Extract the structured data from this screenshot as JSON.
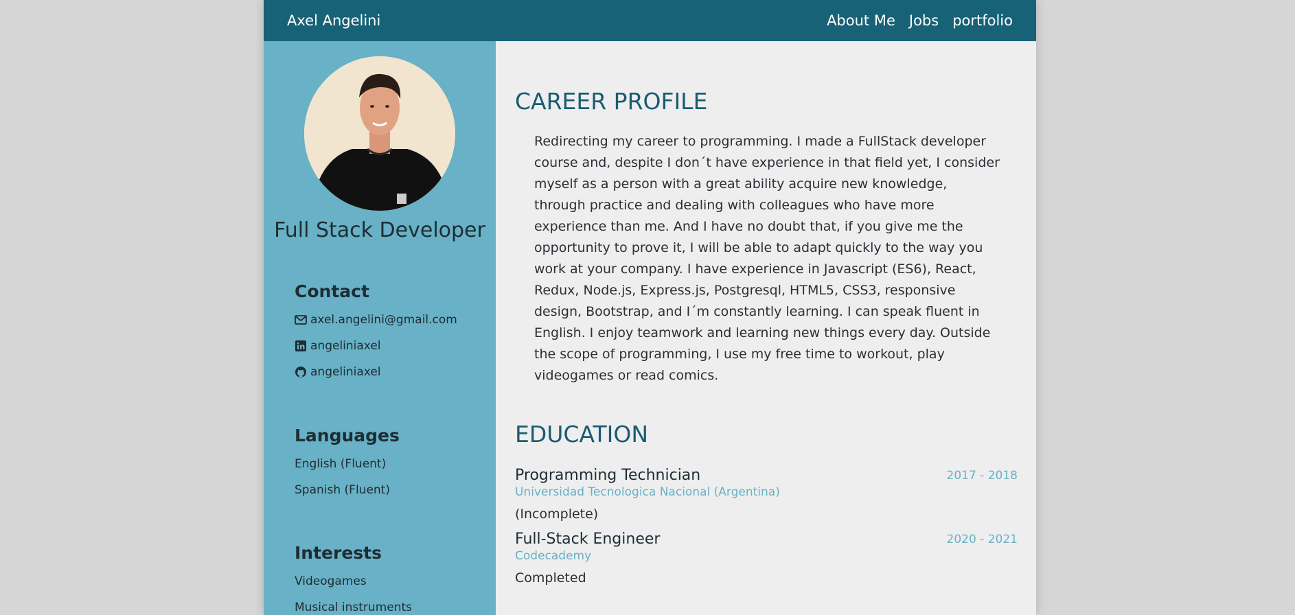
{
  "navbar": {
    "brand": "Axel Angelini",
    "links": [
      "About Me",
      "Jobs",
      "portfolio"
    ]
  },
  "sidebar": {
    "job_title": "Full Stack Developer",
    "contact": {
      "heading": "Contact",
      "email": "axel.angelini@gmail.com",
      "linkedin": "angeliniaxel",
      "github": "angeliniaxel"
    },
    "languages": {
      "heading": "Languages",
      "items": [
        "English (Fluent)",
        "Spanish (Fluent)"
      ]
    },
    "interests": {
      "heading": "Interests",
      "items": [
        "Videogames",
        "Musical instruments"
      ]
    }
  },
  "main": {
    "career": {
      "title": "CAREER PROFILE",
      "text": "Redirecting my career to programming. I made a FullStack developer course and, despite I don´t have experience in that field yet, I consider myself as a person with a great ability acquire new knowledge, through practice and dealing with colleagues who have more experience than me. And I have no doubt that, if you give me the opportunity to prove it, I will be able to adapt quickly to the way you work at your company. I have experience in Javascript (ES6), React, Redux, Node.js, Express.js, Postgresql, HTML5, CSS3, responsive design, Bootstrap, and I´m constantly learning. I can speak fluent in English. I enjoy teamwork and learning new things every day. Outside the scope of programming, I use my free time to workout, play videogames or read comics."
    },
    "education": {
      "title": "EDUCATION",
      "items": [
        {
          "degree": "Programming Technician",
          "years": "2017 - 2018",
          "school": "Universidad Tecnologica Nacional (Argentina)",
          "status": "(Incomplete)"
        },
        {
          "degree": "Full-Stack Engineer",
          "years": "2020 - 2021",
          "school": "Codecademy",
          "status": "Completed"
        }
      ]
    }
  },
  "colors": {
    "navbar": "#176277",
    "sidebar": "#68b1c6",
    "heading": "#1b5b70",
    "accent": "#68b1c6",
    "background": "#d7d6d7"
  }
}
